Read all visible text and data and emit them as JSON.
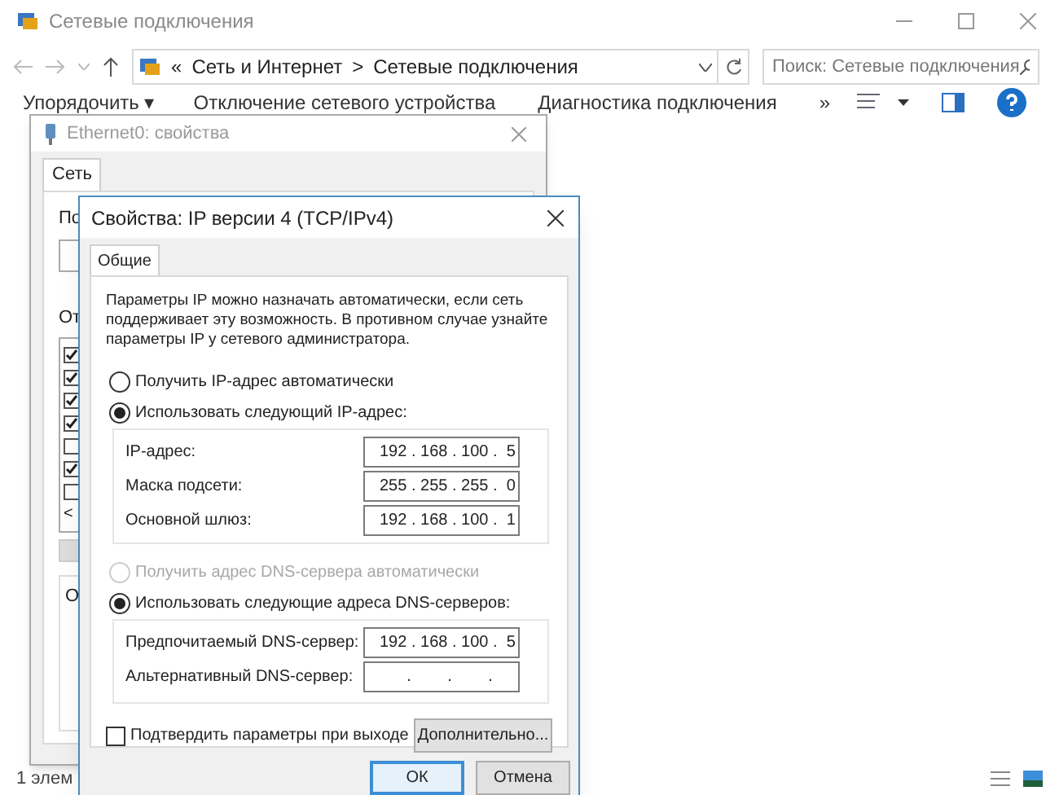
{
  "explorer": {
    "title": "Сетевые подключения",
    "address": {
      "overflow": "«",
      "crumbs": [
        "Сеть и Интернет",
        "Сетевые подключения"
      ],
      "separator": ">"
    },
    "search": {
      "placeholder": "Поиск: Сетевые подключения"
    },
    "toolbar": [
      "Упорядочить ▾",
      "Отключение сетевого устройства",
      "Диагностика подключения",
      "»"
    ],
    "status_bar": "1 элем"
  },
  "ethernet_dialog": {
    "title": "Ethernet0: свойства",
    "tabs": [
      {
        "label": "Сеть",
        "selected": true
      }
    ],
    "label_1": "По",
    "label_2": "От",
    "label_3": "О",
    "components": [
      {
        "checked": true
      },
      {
        "checked": true
      },
      {
        "checked": true
      },
      {
        "checked": true
      },
      {
        "checked": false
      },
      {
        "checked": true
      },
      {
        "checked": false
      }
    ],
    "scroll_arrow": "<"
  },
  "ipv4_dialog": {
    "title": "Свойства: IP версии 4 (TCP/IPv4)",
    "tabs": [
      {
        "label": "Общие",
        "selected": true
      }
    ],
    "description": "Параметры IP можно назначать автоматически, если сеть поддерживает эту возможность. В противном случае узнайте параметры IP у сетевого администратора.",
    "ip_options": [
      {
        "label": "Получить IP-адрес автоматически",
        "selected": false,
        "disabled": false
      },
      {
        "label": "Использовать следующий IP-адрес:",
        "selected": true,
        "disabled": false
      }
    ],
    "ip_fields": [
      {
        "label": "IP-адрес:",
        "value": "192 . 168 . 100 .  5"
      },
      {
        "label": "Маска подсети:",
        "value": "255 . 255 . 255 .  0"
      },
      {
        "label": "Основной шлюз:",
        "value": "192 . 168 . 100 .  1"
      }
    ],
    "dns_options": [
      {
        "label": "Получить адрес DNS-сервера автоматически",
        "selected": false,
        "disabled": true
      },
      {
        "label": "Использовать следующие адреса DNS-серверов:",
        "selected": true,
        "disabled": false
      }
    ],
    "dns_fields": [
      {
        "label": "Предпочитаемый DNS-сервер:",
        "value": "192 . 168 . 100 .  5"
      },
      {
        "label": "Альтернативный DNS-сервер:",
        "value": "      .        .        ."
      }
    ],
    "validate": {
      "label": "Подтвердить параметры при выходе",
      "checked": false
    },
    "advanced_button": "Дополнительно...",
    "buttons": [
      {
        "label": "ОК",
        "focused": true
      },
      {
        "label": "Отмена",
        "focused": false
      }
    ]
  }
}
